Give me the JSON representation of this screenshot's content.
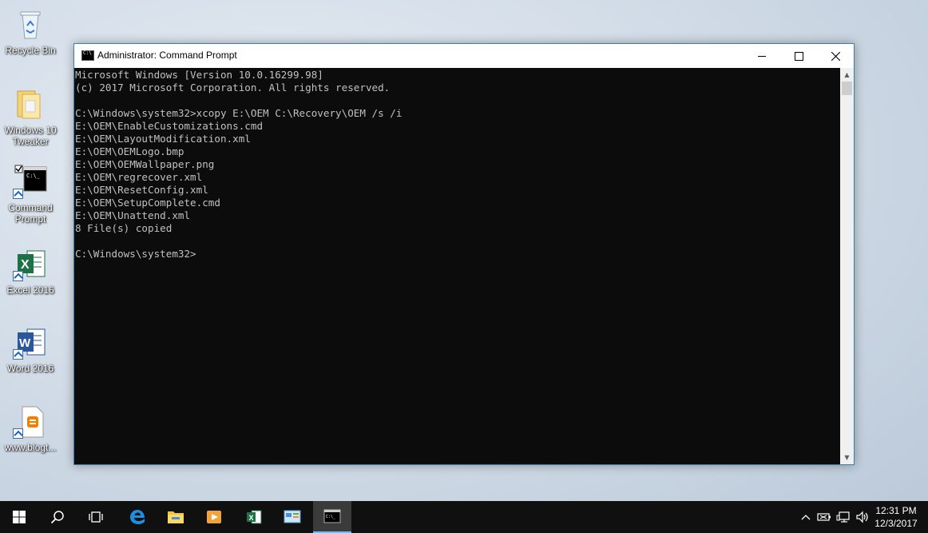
{
  "desktop": {
    "icons": [
      {
        "label": "Recycle Bin"
      },
      {
        "label": "Windows 10 Tweaker"
      },
      {
        "label": "Command Prompt"
      },
      {
        "label": "Excel 2016"
      },
      {
        "label": "Word 2016"
      },
      {
        "label": "www.blogt..."
      }
    ]
  },
  "window": {
    "title": "Administrator: Command Prompt",
    "console_lines": [
      "Microsoft Windows [Version 10.0.16299.98]",
      "(c) 2017 Microsoft Corporation. All rights reserved.",
      "",
      "C:\\Windows\\system32>xcopy E:\\OEM C:\\Recovery\\OEM /s /i",
      "E:\\OEM\\EnableCustomizations.cmd",
      "E:\\OEM\\LayoutModification.xml",
      "E:\\OEM\\OEMLogo.bmp",
      "E:\\OEM\\OEMWallpaper.png",
      "E:\\OEM\\regrecover.xml",
      "E:\\OEM\\ResetConfig.xml",
      "E:\\OEM\\SetupComplete.cmd",
      "E:\\OEM\\Unattend.xml",
      "8 File(s) copied",
      "",
      "C:\\Windows\\system32>"
    ]
  },
  "taskbar": {
    "time": "12:31 PM",
    "date": "12/3/2017"
  },
  "colors": {
    "console_bg": "#0c0c0c",
    "console_fg": "#c0c0c0",
    "taskbar_bg": "#101010",
    "accent": "#76b9ed"
  }
}
